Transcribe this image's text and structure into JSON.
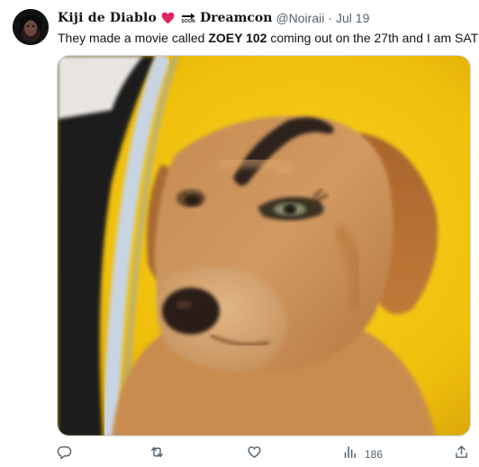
{
  "tweet": {
    "author": {
      "display_name": "Kiji de Diablo",
      "display_name_2": "Dreamcon",
      "handle": "@Noiraii",
      "separator": "·",
      "date": "Jul 19",
      "emojis": [
        "red-heart",
        "soon-arrow"
      ],
      "soon_label": "SOON"
    },
    "text": {
      "before": "They made a movie called ",
      "bold": "ZOEY 102",
      "after": " coming out on the 27th and I am SAT"
    },
    "media": {
      "description_icon": "dog-with-drawn-eyebrow-photo"
    },
    "actions": {
      "reply": {
        "icon": "reply-icon"
      },
      "retweet": {
        "icon": "retweet-icon"
      },
      "like": {
        "icon": "heart-icon"
      },
      "views": {
        "icon": "views-icon",
        "count": "186"
      },
      "share": {
        "icon": "share-icon"
      }
    }
  },
  "colors": {
    "background": "#ffffff",
    "text": "#0f1419",
    "secondary_text": "#536471",
    "heart": "#e0245e",
    "image_yellow": "#f2c40f",
    "dog_fur": "#c98d52"
  }
}
